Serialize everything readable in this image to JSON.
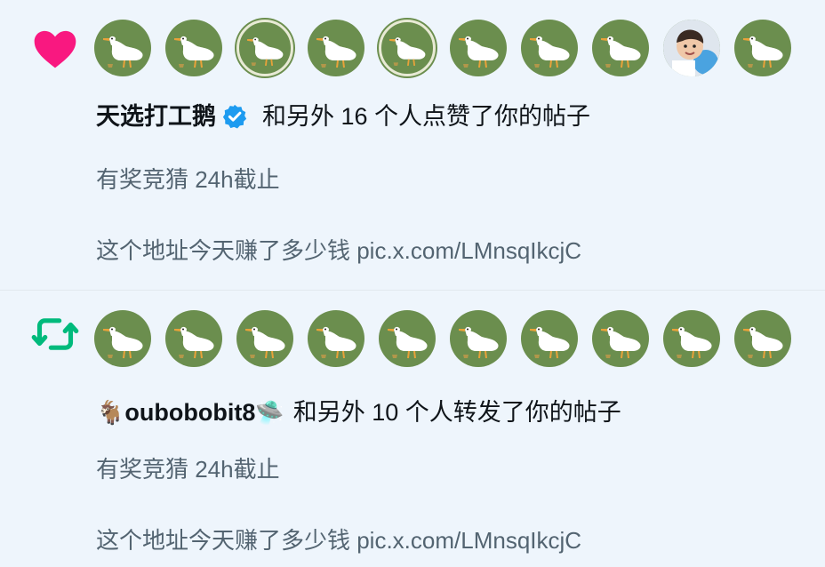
{
  "notifications": [
    {
      "type": "like",
      "icon": "heart-icon",
      "icon_color": "#f91880",
      "avatars": [
        "goose-avatar",
        "goose-avatar",
        "goose-avatar",
        "goose-avatar",
        "goose-avatar",
        "goose-avatar",
        "goose-avatar",
        "goose-avatar",
        "child-photo-avatar",
        "goose-avatar"
      ],
      "actor_name": "天选打工鹅",
      "verified": true,
      "action_text": "和另外 16 个人点赞了你的帖子",
      "post_line_1": "有奖竞猜 24h截止",
      "post_line_2": "这个地址今天赚了多少钱 pic.x.com/LMnsqIkcjC"
    },
    {
      "type": "repost",
      "icon": "repost-icon",
      "icon_color": "#00ba7c",
      "avatars": [
        "goose-avatar",
        "goose-avatar",
        "goose-avatar",
        "goose-avatar",
        "goose-avatar",
        "goose-avatar",
        "goose-avatar",
        "goose-avatar",
        "goose-avatar",
        "goose-avatar"
      ],
      "actor_prefix_emoji": "🐐",
      "actor_name": "oubobobit8",
      "actor_suffix_emoji": "🛸",
      "action_text": "和另外 10 个人转发了你的帖子",
      "post_line_1": "有奖竞猜 24h截止",
      "post_line_2": "这个地址今天赚了多少钱 pic.x.com/LMnsqIkcjC"
    }
  ],
  "colors": {
    "background": "#eef5fc",
    "avatar_green": "#6b8e4e",
    "verified_blue": "#1d9bf0",
    "secondary_text": "#536471"
  }
}
